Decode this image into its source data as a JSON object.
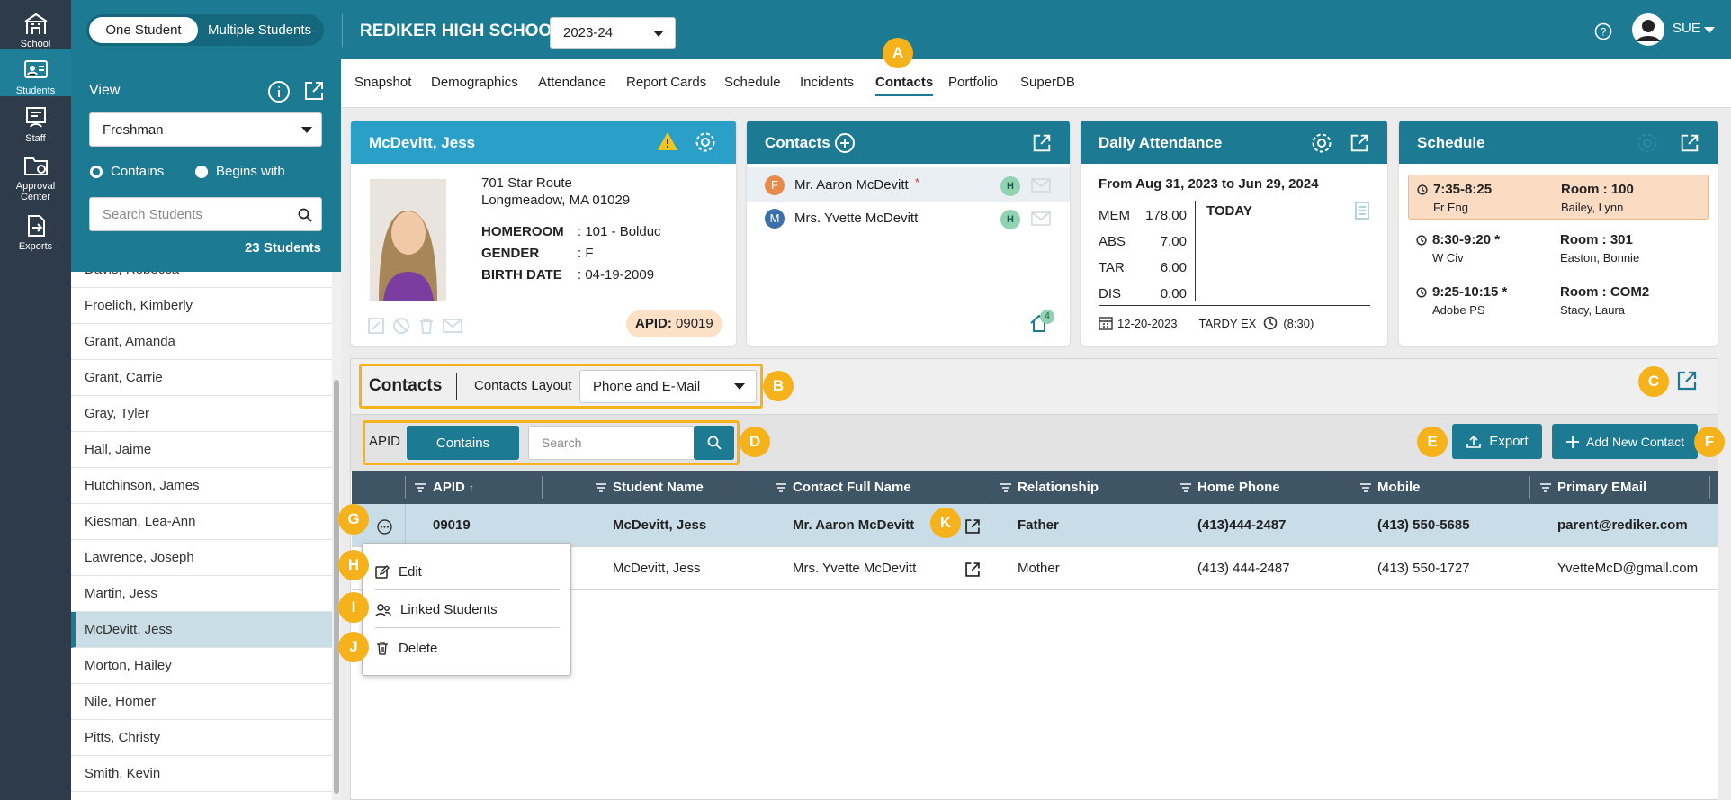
{
  "rail": [
    {
      "label": "School",
      "icon": "school-icon"
    },
    {
      "label": "Students",
      "icon": "students-icon"
    },
    {
      "label": "Staff",
      "icon": "staff-icon"
    },
    {
      "label": "Approval",
      "label2": "Center",
      "icon": "approval-icon"
    },
    {
      "label": "Exports",
      "icon": "exports-icon"
    }
  ],
  "topbar": {
    "mode_on": "One Student",
    "mode_off": "Multiple Students",
    "school": "REDIKER HIGH SCHOOL",
    "year": "2023-24",
    "user": "SUE"
  },
  "view": {
    "title": "View",
    "grade": "Freshman",
    "radio_contains": "Contains",
    "radio_begins": "Begins with",
    "search_placeholder": "Search Students",
    "count": "23 Students"
  },
  "students": [
    "Davis, Rebecca",
    "Froelich, Kimberly",
    "Grant, Amanda",
    "Grant, Carrie",
    "Gray, Tyler",
    "Hall, Jaime",
    "Hutchinson, James",
    "Kiesman, Lea-Ann",
    "Lawrence, Joseph",
    "Martin, Jess",
    "McDevitt, Jess",
    "Morton, Hailey",
    "Nile, Homer",
    "Pitts, Christy",
    "Smith, Kevin"
  ],
  "tabs": [
    "Snapshot",
    "Demographics",
    "Attendance",
    "Report Cards",
    "Schedule",
    "Incidents",
    "Contacts",
    "Portfolio",
    "SuperDB"
  ],
  "student_card": {
    "name": "McDevitt, Jess",
    "addr1": "701 Star Route",
    "addr2": "Longmeadow, MA 01029",
    "homeroom_lbl": "HOMEROOM",
    "homeroom": ": 101 - Bolduc",
    "gender_lbl": "GENDER",
    "gender": ": F",
    "birth_lbl": "BIRTH DATE",
    "birth": ": 04-19-2009",
    "apid_lbl": "APID:",
    "apid": "09019"
  },
  "contacts_card": {
    "title": "Contacts",
    "c1_badge": "F",
    "c1": "Mr. Aaron McDevitt",
    "c1_star": "*",
    "c2_badge": "M",
    "c2": "Mrs. Yvette McDevitt",
    "h": "H",
    "home_count": "4"
  },
  "attendance_card": {
    "title": "Daily Attendance",
    "range": "From Aug 31, 2023 to Jun 29, 2024",
    "rows": [
      [
        "MEM",
        "178.00"
      ],
      [
        "ABS",
        "7.00"
      ],
      [
        "TAR",
        "6.00"
      ],
      [
        "DIS",
        "0.00"
      ]
    ],
    "today": "TODAY",
    "date": "12-20-2023",
    "tardy": "TARDY EX",
    "time": "(8:30)"
  },
  "schedule_card": {
    "title": "Schedule",
    "rows": [
      {
        "time": "7:35-8:25",
        "course": "Fr Eng",
        "room": "Room : 100",
        "teacher": "Bailey, Lynn"
      },
      {
        "time": "8:30-9:20 *",
        "course": "W Civ",
        "room": "Room : 301",
        "teacher": "Easton, Bonnie"
      },
      {
        "time": "9:25-10:15 *",
        "course": "Adobe PS",
        "room": "Room : COM2",
        "teacher": "Stacy, Laura"
      }
    ]
  },
  "contacts_panel": {
    "title": "Contacts",
    "layout_lbl": "Contacts Layout",
    "layout": "Phone and E-Mail",
    "apid_lbl": "APID",
    "contains": "Contains",
    "search_placeholder": "Search",
    "export": "Export",
    "add": "Add New Contact"
  },
  "grid": {
    "headers": [
      "APID",
      "Student Name",
      "Contact Full Name",
      "Relationship",
      "Home Phone",
      "Mobile",
      "Primary EMail"
    ],
    "rows": [
      [
        "09019",
        "McDevitt, Jess",
        "Mr. Aaron McDevitt",
        "Father",
        "(413)444-2487",
        "(413) 550-5685",
        "parent@rediker.com"
      ],
      [
        "",
        "McDevitt, Jess",
        "Mrs. Yvette McDevitt",
        "Mother",
        "(413) 444-2487",
        "(413) 550-1727",
        "YvetteMcD@gmall.com"
      ]
    ]
  },
  "row_menu": [
    "Edit",
    "Linked Students",
    "Delete"
  ],
  "callouts": [
    "A",
    "B",
    "C",
    "D",
    "E",
    "F",
    "G",
    "H",
    "I",
    "J",
    "K"
  ],
  "colors": {
    "brand": "#1c7a93",
    "callout": "#f5b21b",
    "rail": "#2d3b4a"
  }
}
